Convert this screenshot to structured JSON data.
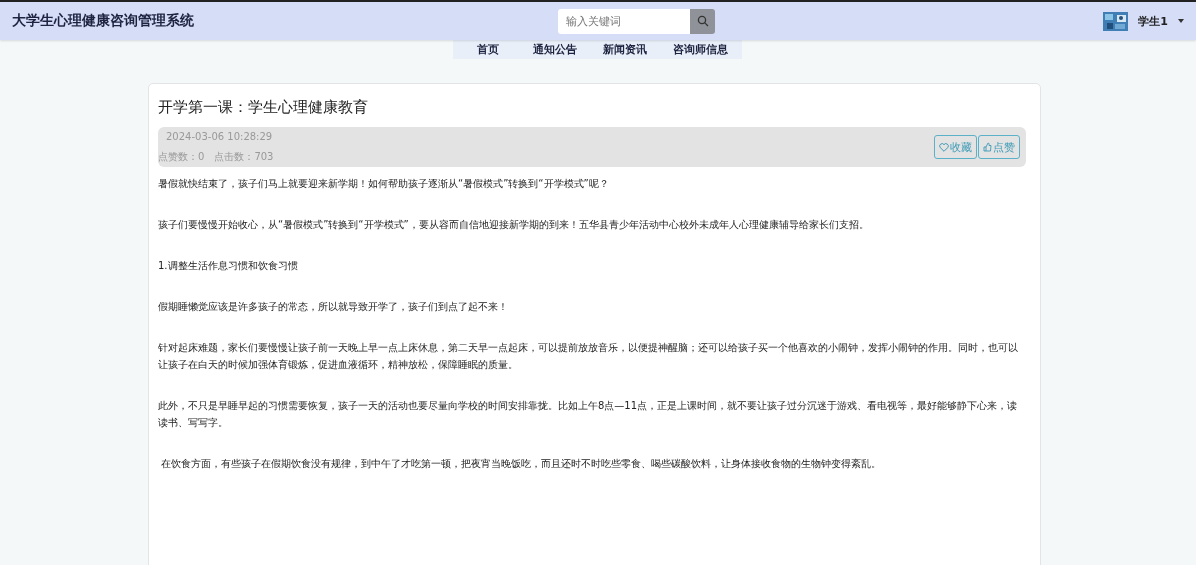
{
  "header": {
    "title": "大学生心理健康咨询管理系统",
    "search": {
      "placeholder": "输入关键词"
    },
    "user": {
      "name": "学生1"
    }
  },
  "nav": [
    {
      "label": "首页"
    },
    {
      "label": "通知公告"
    },
    {
      "label": "新闻资讯"
    },
    {
      "label": "咨询师信息"
    }
  ],
  "article": {
    "title": "开学第一课：学生心理健康教育",
    "date": "2024-03-06 10:28:29",
    "likes": "点赞数：0",
    "clicks": "点击数：703",
    "buttons": [
      {
        "kind": "heart",
        "label": "收藏"
      },
      {
        "kind": "thumb",
        "label": "点赞"
      }
    ],
    "paragraphs": [
      "暑假就快结束了，孩子们马上就要迎来新学期！如何帮助孩子逐渐从“暑假模式”转换到“开学模式”呢？",
      "孩子们要慢慢开始收心，从“暑假模式”转换到“开学模式”，要从容而自信地迎接新学期的到来！五华县青少年活动中心校外未成年人心理健康辅导给家长们支招。",
      "1.调整生活作息习惯和饮食习惯",
      "假期睡懒觉应该是许多孩子的常态，所以就导致开学了，孩子们到点了起不来！",
      "针对起床难题，家长们要慢慢让孩子前一天晚上早一点上床休息，第二天早一点起床，可以提前放放音乐，以便提神醒脑；还可以给孩子买一个他喜欢的小闹钟，发挥小闹钟的作用。同时，也可以让孩子在白天的时候加强体育锻炼，促进血液循环，精神放松，保障睡眠的质量。",
      "此外，不只是早睡早起的习惯需要恢复，孩子一天的活动也要尽量向学校的时间安排靠拢。比如上午8点—11点，正是上课时间，就不要让孩子过分沉迷于游戏、看电视等，最好能够静下心来，读读书、写写字。",
      " 在饮食方面，有些孩子在假期饮食没有规律，到中午了才吃第一顿，把夜宵当晚饭吃，而且还时不时吃些零食、喝些碳酸饮料，让身体接收食物的生物钟变得紊乱。"
    ]
  }
}
